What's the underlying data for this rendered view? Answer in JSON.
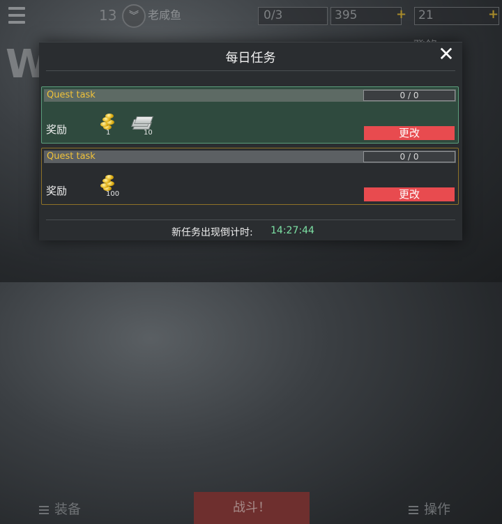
{
  "hud": {
    "level": "13",
    "player_name": "老咸鱼",
    "resources": [
      {
        "value": "0/3",
        "icon": "cash-icon"
      },
      {
        "value": "395",
        "icon": "gold-plus-icon"
      },
      {
        "value": "21",
        "icon": "cash-plus-icon"
      }
    ],
    "login_text": "登錄",
    "bottom": {
      "equip_label": "装备",
      "fight_label": "战斗！",
      "operate_label": "操作"
    }
  },
  "dialog": {
    "title": "每日任务",
    "close_icon": "close-icon",
    "quests": [
      {
        "name": "Quest task",
        "progress": "0 / 0",
        "reward_label": "奖励",
        "rewards": [
          {
            "icon": "gold-coins-icon",
            "qty": "1"
          },
          {
            "icon": "cash-stack-icon",
            "qty": "10"
          }
        ],
        "change_label": "更改",
        "state": "highlighted"
      },
      {
        "name": "Quest task",
        "progress": "0 / 0",
        "reward_label": "奖励",
        "rewards": [
          {
            "icon": "gold-coins-icon",
            "qty": "100"
          }
        ],
        "change_label": "更改",
        "state": "normal"
      }
    ],
    "timer_label": "新任务出现倒计时:",
    "timer_value": "14:27:44"
  },
  "colors": {
    "accent_gold": "#f0c23a",
    "button_red": "#e84b4f",
    "timer_green": "#7de2a5",
    "highlight_border": "#5c9e7c"
  }
}
